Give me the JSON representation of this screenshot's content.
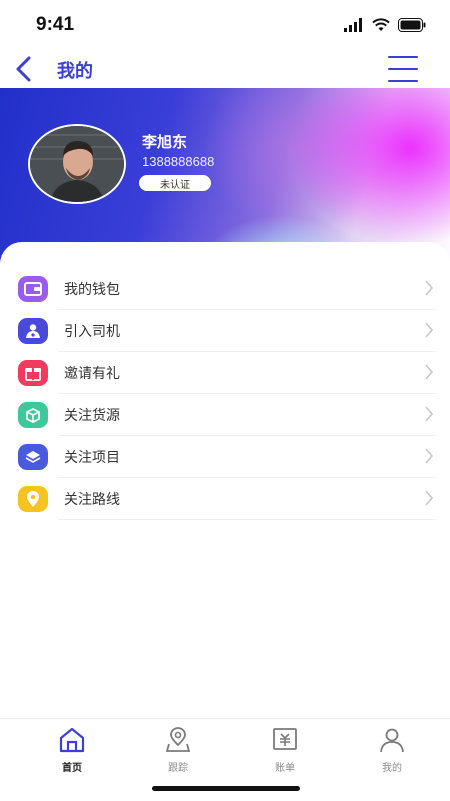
{
  "status": {
    "time": "9:41"
  },
  "nav": {
    "title": "我的"
  },
  "profile": {
    "name": "李旭东",
    "phone": "1388888688",
    "badge": "未认证"
  },
  "menu": [
    {
      "label": "我的钱包",
      "icon": "wallet-icon",
      "color": "#9a5cf0"
    },
    {
      "label": "引入司机",
      "icon": "driver-icon",
      "color": "#4a4ad8"
    },
    {
      "label": "邀请有礼",
      "icon": "gift-icon",
      "color": "#f23a5c"
    },
    {
      "label": "关注货源",
      "icon": "cargo-icon",
      "color": "#3fc79a"
    },
    {
      "label": "关注项目",
      "icon": "layers-icon",
      "color": "#4a5adf"
    },
    {
      "label": "关注路线",
      "icon": "location-icon",
      "color": "#f6c321"
    }
  ],
  "tabs": [
    {
      "label": "首页",
      "icon": "home-icon",
      "active": true
    },
    {
      "label": "跟踪",
      "icon": "track-icon",
      "active": false
    },
    {
      "label": "账单",
      "icon": "bill-icon",
      "active": false
    },
    {
      "label": "我的",
      "icon": "user-icon",
      "active": false
    }
  ],
  "colors": {
    "accent": "#3a3fd6",
    "banner_start": "#2130c9",
    "banner_magenta": "#e628ff"
  }
}
